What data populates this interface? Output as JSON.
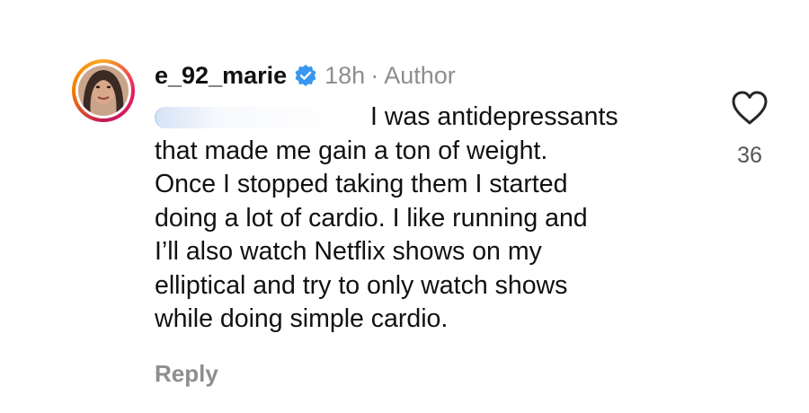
{
  "comment": {
    "username": "e_92_marie",
    "verified_icon": "verified-badge-icon",
    "time": "18h",
    "separator": "·",
    "author_label": "Author",
    "mention_icon": "blurred-mention",
    "body_lines": [
      "I was antidepressants",
      "that made me gain a ton of weight.",
      "Once I stopped taking them I started",
      "doing a lot of cardio. I like running and",
      "I’ll also watch Netflix shows on my",
      "elliptical and try to only watch shows",
      "while doing simple cardio."
    ],
    "like_icon": "heart-outline-icon",
    "like_count": "36",
    "reply_label": "Reply"
  },
  "colors": {
    "verified": "#3897f0",
    "muted_text": "#8e8e8e",
    "text": "#111111"
  }
}
